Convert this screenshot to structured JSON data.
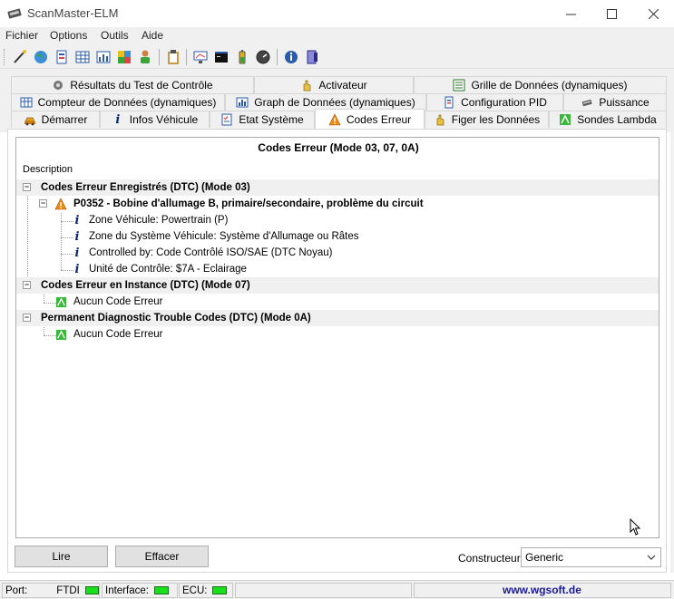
{
  "window": {
    "title": "ScanMaster-ELM"
  },
  "menu": [
    "Fichier",
    "Options",
    "Outils",
    "Aide"
  ],
  "toolbar": {
    "icons": [
      "wand-icon",
      "globe-icon",
      "document-icon",
      "grid-icon",
      "graph-icon",
      "map-icon",
      "user-icon",
      "clipboard-icon",
      "monitor-icon",
      "terminal-icon",
      "battery-icon",
      "gauge-icon",
      "info-icon",
      "exit-icon"
    ]
  },
  "tabs": {
    "row1": [
      {
        "label": "Résultats du Test de Contrôle",
        "icon": "gear-icon"
      },
      {
        "label": "Activateur",
        "icon": "hand-icon"
      },
      {
        "label": "Grille de Données (dynamiques)",
        "icon": "list-icon"
      }
    ],
    "row2": [
      {
        "label": "Compteur de Données (dynamiques)",
        "icon": "table-icon"
      },
      {
        "label": "Graph de Données (dynamiques)",
        "icon": "chart-icon"
      },
      {
        "label": "Configuration PID",
        "icon": "document-icon"
      },
      {
        "label": "Puissance",
        "icon": "chip-icon"
      }
    ],
    "row3": [
      {
        "label": "Démarrer",
        "icon": "car-icon"
      },
      {
        "label": "Infos Véhicule",
        "icon": "info-icon"
      },
      {
        "label": "Etat Système",
        "icon": "checklist-icon"
      },
      {
        "label": "Codes Erreur",
        "icon": "warning-icon",
        "active": true
      },
      {
        "label": "Figer les Données",
        "icon": "hand-icon"
      },
      {
        "label": "Sondes Lambda",
        "icon": "lambda-icon"
      }
    ]
  },
  "codes": {
    "header": "Codes Erreur (Mode 03, 07, 0A)",
    "description_label": "Description",
    "groups": [
      {
        "title": "Codes Erreur Enregistrés (DTC) (Mode 03)",
        "dtc": {
          "code_text": "P0352 - Bobine d'allumage B, primaire/secondaire, problème du circuit",
          "details": [
            "Zone Véhicule: Powertrain (P)",
            "Zone du Système Véhicule: Système d'Allumage ou Râtes",
            "Controlled by: Code Contrôlé ISO/SAE (DTC Noyau)",
            "Unité de Contrôle: $7A - Eclairage"
          ]
        }
      },
      {
        "title": "Codes Erreur en Instance (DTC) (Mode 07)",
        "item": "Aucun Code Erreur"
      },
      {
        "title": "Permanent Diagnostic Trouble Codes (DTC) (Mode 0A)",
        "item": "Aucun Code Erreur"
      }
    ],
    "buttons": {
      "read": "Lire",
      "clear": "Effacer"
    },
    "manufacturer_label": "Constructeur",
    "manufacturer_value": "Generic"
  },
  "status": {
    "port_label": "Port:",
    "port_value": "FTDI",
    "interface_label": "Interface:",
    "ecu_label": "ECU:",
    "link": "www.wgsoft.de",
    "led_color": "#19e01a"
  }
}
